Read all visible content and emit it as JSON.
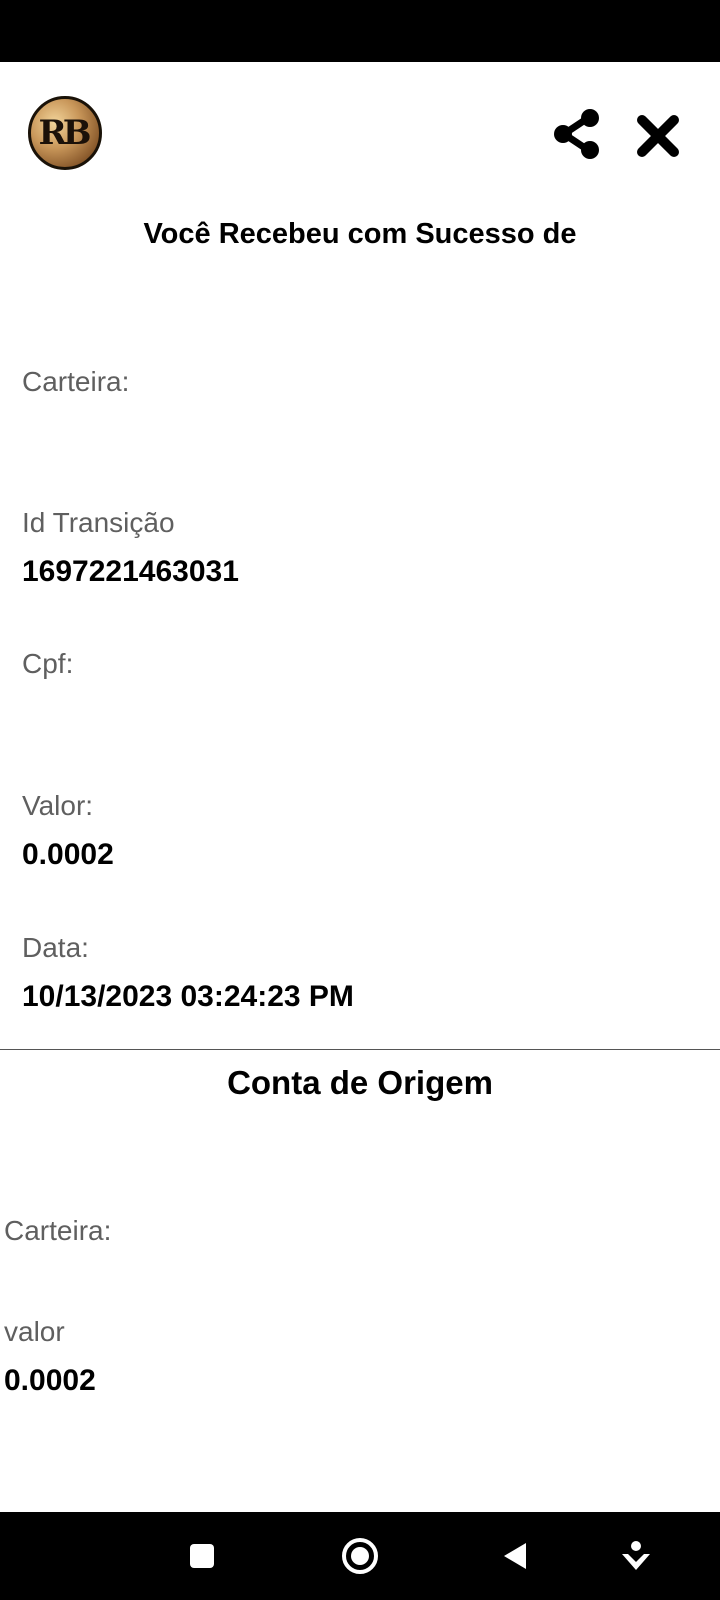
{
  "header": {
    "logo_text": "RB",
    "share_icon": "share-icon",
    "close_icon": "close-icon"
  },
  "title": "Você Recebeu com Sucesso de",
  "details": {
    "carteira_label": "Carteira:",
    "id_label": "Id Transição",
    "id_value": "1697221463031",
    "cpf_label": "Cpf:",
    "valor_label": "Valor:",
    "valor_value": "0.0002",
    "data_label": "Data:",
    "data_value": "10/13/2023 03:24:23 PM"
  },
  "origin": {
    "title": "Conta de Origem",
    "carteira_label": "Carteira:",
    "valor_label": "valor",
    "valor_value": "0.0002"
  },
  "nav": {
    "recents_icon": "square-icon",
    "home_icon": "circle-home-icon",
    "back_icon": "triangle-back-icon",
    "extra_icon": "person-down-icon"
  },
  "colors": {
    "label": "#5f5f5f",
    "value": "#000000",
    "bars": "#000000",
    "nav_icon": "#ffffff"
  }
}
